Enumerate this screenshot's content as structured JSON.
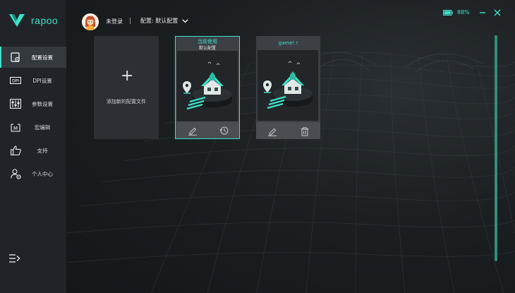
{
  "app": {
    "brand": "rapoo",
    "accent_color": "#3fe0c8"
  },
  "sidebar": {
    "items": [
      {
        "label": "配置设置",
        "icon": "config-icon",
        "active": true
      },
      {
        "label": "DPI设置",
        "icon": "dpi-icon",
        "active": false
      },
      {
        "label": "参数设置",
        "icon": "sliders-icon",
        "active": false
      },
      {
        "label": "宏编辑",
        "icon": "macro-icon",
        "active": false
      },
      {
        "label": "支持",
        "icon": "thumbs-up-icon",
        "active": false
      },
      {
        "label": "个人中心",
        "icon": "user-gear-icon",
        "active": false
      }
    ],
    "collapse_icon": "menu-collapse-icon"
  },
  "header": {
    "login_text": "未登录",
    "profile_select": "配置: 默认配置",
    "battery": "88%",
    "battery_level": 0.88
  },
  "profiles": {
    "add_label": "添加新的配置文件",
    "add_symbol": "+",
    "cards": [
      {
        "status": "当前使用",
        "name": "默认配置",
        "selected": true,
        "actions": [
          "edit-icon",
          "history-icon"
        ]
      },
      {
        "status": "",
        "name": "game! !",
        "selected": false,
        "actions": [
          "edit-icon",
          "trash-icon"
        ]
      }
    ]
  }
}
